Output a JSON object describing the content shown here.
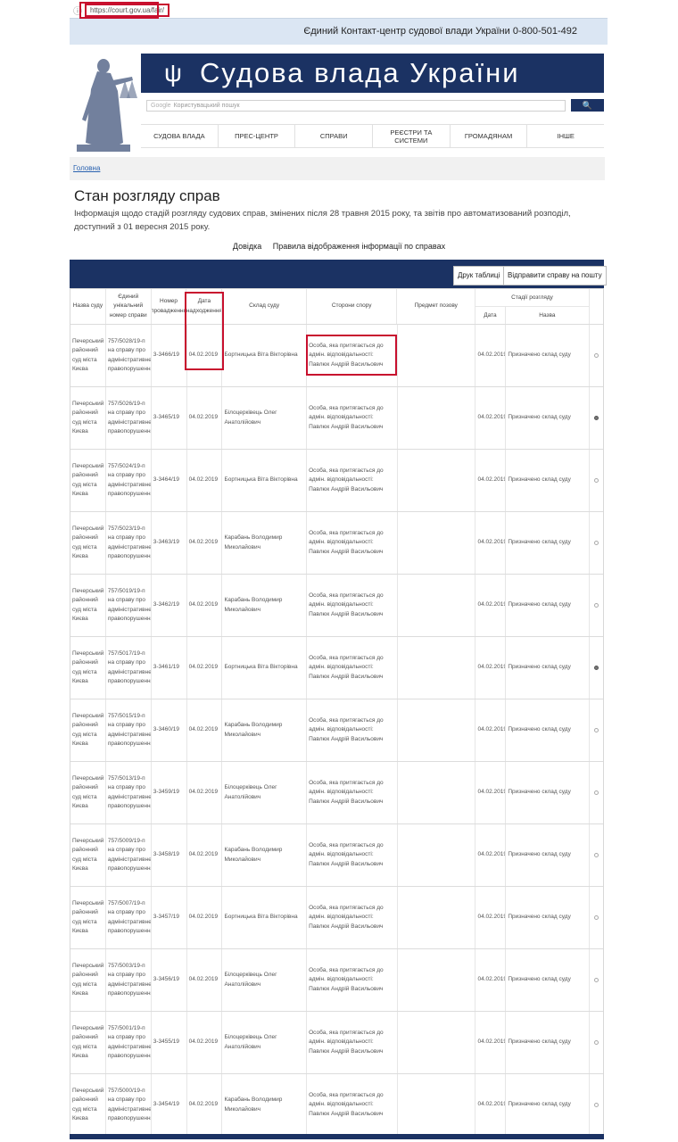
{
  "browser": {
    "url": "https://court.gov.ua/fair/"
  },
  "topbar": {
    "contact": "Єдиний Контакт-центр судової влади України 0-800-501-492"
  },
  "header": {
    "title": "Судова влада України"
  },
  "search": {
    "provider": "Google",
    "placeholder": "Користувацький пошук",
    "button": "🔍"
  },
  "nav": [
    "СУДОВА ВЛАДА",
    "ПРЕС-ЦЕНТР",
    "СПРАВИ",
    "РЕЄСТРИ ТА СИСТЕМИ",
    "ГРОМАДЯНАМ",
    "ІНШЕ"
  ],
  "breadcrumb": {
    "home": "Головна"
  },
  "page": {
    "title": "Стан розгляду справ",
    "intro": "Інформація щодо стадій розгляду судових справ, змінених після 28 травня 2015 року, та звітів про автоматизований розподіл, доступний з 01 вересня 2015 року.",
    "link_help": "Довідка",
    "link_rules": "Правила відображення інформації по справах"
  },
  "toolbar": {
    "print": "Друк таблиці",
    "send": "Відправити справу на пошту"
  },
  "table": {
    "headers": {
      "court": "Назва суду",
      "unique_number": "Єдиний унікальний номер справи",
      "proceeding_number": "Номер провадження",
      "date_received": "Дата надходження",
      "composition": "Склад суду",
      "parties": "Сторони спору",
      "subject": "Предмет позову",
      "stages": "Стадії розгляду",
      "stage_date": "Дата",
      "stage_name": "Назва"
    },
    "rows": [
      {
        "court": "Печерський районний суд міста Києва",
        "unique": "757/5028/19-п",
        "case_type": "на справу про адміністративне правопорушення",
        "proceeding": "3-3466/19",
        "date": "04.02.2019",
        "composition": "Бортницька Віта Вікторівна",
        "parties": "Особа, яка притягається до адмін. відповідальності: Павлюк Андрій Васильович",
        "subject": "",
        "stage_date": "04.02.2019",
        "stage_name": "Призначено склад суду",
        "selected": false
      },
      {
        "court": "Печерський районний суд міста Києва",
        "unique": "757/5026/19-п",
        "case_type": "на справу про адміністративне правопорушення",
        "proceeding": "3-3465/19",
        "date": "04.02.2019",
        "composition": "Білоцерківець Олег Анатолійович",
        "parties": "Особа, яка притягається до адмін. відповідальності: Павлюк Андрій Васильович",
        "subject": "",
        "stage_date": "04.02.2019",
        "stage_name": "Призначено склад суду",
        "selected": true
      },
      {
        "court": "Печерський районний суд міста Києва",
        "unique": "757/5024/19-п",
        "case_type": "на справу про адміністративне правопорушення",
        "proceeding": "3-3464/19",
        "date": "04.02.2019",
        "composition": "Бортницька Віта Вікторівна",
        "parties": "Особа, яка притягається до адмін. відповідальності: Павлюк Андрій Васильович",
        "subject": "",
        "stage_date": "04.02.2019",
        "stage_name": "Призначено склад суду",
        "selected": false
      },
      {
        "court": "Печерський районний суд міста Києва",
        "unique": "757/5023/19-п",
        "case_type": "на справу про адміністративне правопорушення",
        "proceeding": "3-3463/19",
        "date": "04.02.2019",
        "composition": "Карабань Володимир Миколайович",
        "parties": "Особа, яка притягається до адмін. відповідальності: Павлюк Андрій Васильович",
        "subject": "",
        "stage_date": "04.02.2019",
        "stage_name": "Призначено склад суду",
        "selected": false
      },
      {
        "court": "Печерський районний суд міста Києва",
        "unique": "757/5019/19-п",
        "case_type": "на справу про адміністративне правопорушення",
        "proceeding": "3-3462/19",
        "date": "04.02.2019",
        "composition": "Карабань Володимир Миколайович",
        "parties": "Особа, яка притягається до адмін. відповідальності: Павлюк Андрій Васильович",
        "subject": "",
        "stage_date": "04.02.2019",
        "stage_name": "Призначено склад суду",
        "selected": false
      },
      {
        "court": "Печерський районний суд міста Києва",
        "unique": "757/5017/19-п",
        "case_type": "на справу про адміністративне правопорушення",
        "proceeding": "3-3461/19",
        "date": "04.02.2019",
        "composition": "Бортницька Віта Вікторівна",
        "parties": "Особа, яка притягається до адмін. відповідальності: Павлюк Андрій Васильович",
        "subject": "",
        "stage_date": "04.02.2019",
        "stage_name": "Призначено склад суду",
        "selected": true
      },
      {
        "court": "Печерський районний суд міста Києва",
        "unique": "757/5015/19-п",
        "case_type": "на справу про адміністративне правопорушення",
        "proceeding": "3-3460/19",
        "date": "04.02.2019",
        "composition": "Карабань Володимир Миколайович",
        "parties": "Особа, яка притягається до адмін. відповідальності: Павлюк Андрій Васильович",
        "subject": "",
        "stage_date": "04.02.2019",
        "stage_name": "Призначено склад суду",
        "selected": false
      },
      {
        "court": "Печерський районний суд міста Києва",
        "unique": "757/5013/19-п",
        "case_type": "на справу про адміністративне правопорушення",
        "proceeding": "3-3459/19",
        "date": "04.02.2019",
        "composition": "Білоцерківець Олег Анатолійович",
        "parties": "Особа, яка притягається до адмін. відповідальності: Павлюк Андрій Васильович",
        "subject": "",
        "stage_date": "04.02.2019",
        "stage_name": "Призначено склад суду",
        "selected": false
      },
      {
        "court": "Печерський районний суд міста Києва",
        "unique": "757/5009/19-п",
        "case_type": "на справу про адміністративне правопорушення",
        "proceeding": "3-3458/19",
        "date": "04.02.2019",
        "composition": "Карабань Володимир Миколайович",
        "parties": "Особа, яка притягається до адмін. відповідальності: Павлюк Андрій Васильович",
        "subject": "",
        "stage_date": "04.02.2019",
        "stage_name": "Призначено склад суду",
        "selected": false
      },
      {
        "court": "Печерський районний суд міста Києва",
        "unique": "757/5007/19-п",
        "case_type": "на справу про адміністративне правопорушення",
        "proceeding": "3-3457/19",
        "date": "04.02.2019",
        "composition": "Бортницька Віта Вікторівна",
        "parties": "Особа, яка притягається до адмін. відповідальності: Павлюк Андрій Васильович",
        "subject": "",
        "stage_date": "04.02.2019",
        "stage_name": "Призначено склад суду",
        "selected": false
      },
      {
        "court": "Печерський районний суд міста Києва",
        "unique": "757/5003/19-п",
        "case_type": "на справу про адміністративне правопорушення",
        "proceeding": "3-3456/19",
        "date": "04.02.2019",
        "composition": "Білоцерківець Олег Анатолійович",
        "parties": "Особа, яка притягається до адмін. відповідальності: Павлюк Андрій Васильович",
        "subject": "",
        "stage_date": "04.02.2019",
        "stage_name": "Призначено склад суду",
        "selected": false
      },
      {
        "court": "Печерський районний суд міста Києва",
        "unique": "757/5001/19-п",
        "case_type": "на справу про адміністративне правопорушення",
        "proceeding": "3-3455/19",
        "date": "04.02.2019",
        "composition": "Білоцерківець Олег Анатолійович",
        "parties": "Особа, яка притягається до адмін. відповідальності: Павлюк Андрій Васильович",
        "subject": "",
        "stage_date": "04.02.2019",
        "stage_name": "Призначено склад суду",
        "selected": false
      },
      {
        "court": "Печерський районний суд міста Києва",
        "unique": "757/5000/19-п",
        "case_type": "на справу про адміністративне правопорушення",
        "proceeding": "3-3454/19",
        "date": "04.02.2019",
        "composition": "Карабань Володимир Миколайович",
        "parties": "Особа, яка притягається до адмін. відповідальності: Павлюк Андрій Васильович",
        "subject": "",
        "stage_date": "04.02.2019",
        "stage_name": "Призначено склад суду",
        "selected": false
      }
    ]
  },
  "colors": {
    "navy": "#1b3263",
    "highlight": "#c8102e",
    "link": "#2a62b0"
  }
}
